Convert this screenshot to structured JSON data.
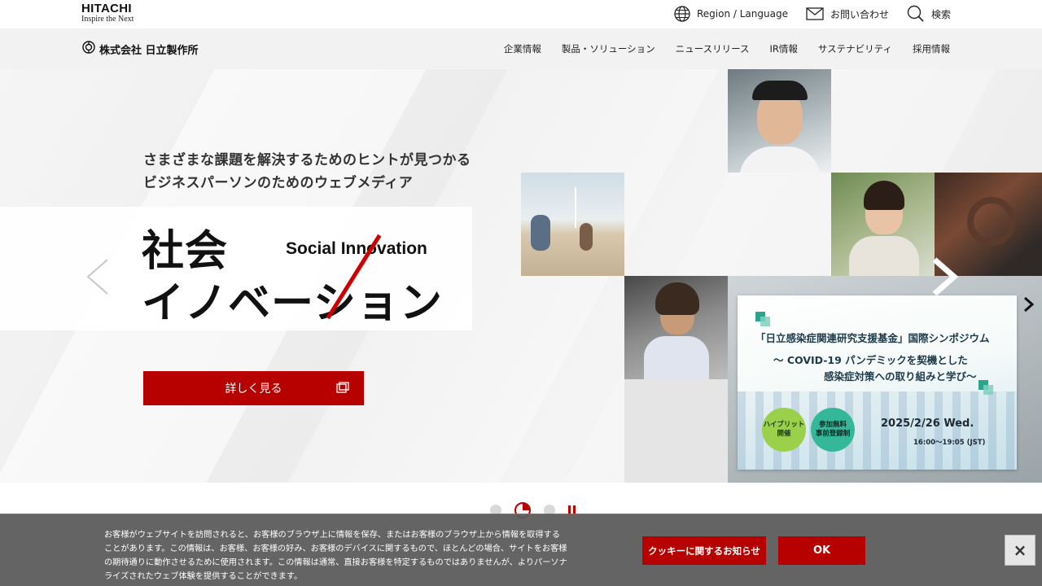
{
  "header": {
    "logo": {
      "brand": "HITACHI",
      "tagline": "Inspire the Next"
    },
    "utilities": {
      "region": "Region / Language",
      "contact": "お問い合わせ",
      "search": "検索"
    }
  },
  "navbar": {
    "corporate_name": "株式会社 日立製作所",
    "items": [
      "企業情報",
      "製品・ソリューション",
      "ニュースリリース",
      "IR情報",
      "サステナビリティ",
      "採用情報"
    ]
  },
  "hero": {
    "subheading_line1": "さまざまな課題を解決するためのヒントが見つかる",
    "subheading_line2": "ビジネスパーソンのためのウェブメディア",
    "title_line1": "社会",
    "title_line2": "イノベーション",
    "title_en": "Social Innovation",
    "cta_label": "詳しく見る",
    "icons": {
      "prev": "chevron-left-icon",
      "next": "chevron-right-icon",
      "cta": "external-window-icon"
    }
  },
  "banner": {
    "title": "「日立感染症関連研究支援基金」国際シンポジウム",
    "line1": "～ COVID-19 パンデミックを契機とした",
    "line2": "感染症対策への取り組みと学び～",
    "badge1_line1": "ハイブリット",
    "badge1_line2": "開催",
    "badge2_line1": "参加無料",
    "badge2_line2": "事前登録制",
    "date": "2025/2/26 Wed.",
    "time": "16:00～19:05 (JST)"
  },
  "pager": {
    "count": 3,
    "active_index": 1
  },
  "cookie": {
    "text": "お客様がウェブサイトを訪問されると、お客様のブラウザ上に情報を保存、またはお客様のブラウザ上から情報を取得することがあります。この情報は、お客様、お客様の好み、お客様のデバイスに関するもので、ほとんどの場合、サイトをお客様の期待通りに動作させるために使用されます。この情報は通常、直接お客様を特定するものではありませんが、よりパーソナライズされたウェブ体験を提供することができます。",
    "notice_button": "クッキーに関するお知らせ",
    "ok_button": "OK",
    "close_glyph": "×"
  },
  "colors": {
    "accent": "#b70000",
    "nav_bg": "#f2f2f2",
    "cookie_bg": "#5a5a5a"
  }
}
